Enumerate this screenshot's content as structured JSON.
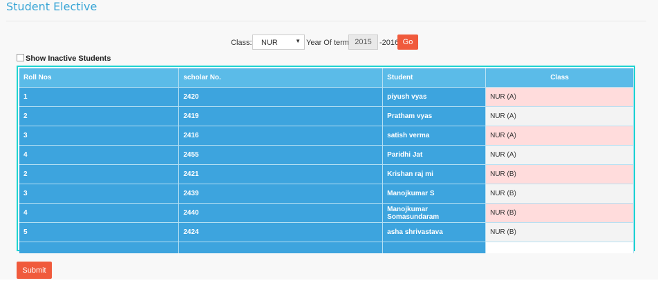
{
  "page": {
    "title": "Student Elective"
  },
  "filters": {
    "class_label": "Class:-",
    "class_value": "NUR",
    "year_label": "Year Of term:-",
    "year_start": "2015",
    "year_end": "-2016",
    "go_label": "Go"
  },
  "inactive_label": "Show Inactive Students",
  "table": {
    "headers": [
      "Roll Nos",
      "scholar No.",
      "Student",
      "Class"
    ],
    "rows": [
      {
        "roll": "1",
        "scholar": "2420",
        "student": "piyush vyas",
        "class": "NUR (A)"
      },
      {
        "roll": "2",
        "scholar": "2419",
        "student": "Pratham vyas",
        "class": "NUR (A)"
      },
      {
        "roll": "3",
        "scholar": "2416",
        "student": "satish verma",
        "class": "NUR (A)"
      },
      {
        "roll": "4",
        "scholar": "2455",
        "student": "Paridhi Jat",
        "class": "NUR (A)"
      },
      {
        "roll": "2",
        "scholar": "2421",
        "student": "Krishan raj mi",
        "class": "NUR (B)"
      },
      {
        "roll": "3",
        "scholar": "2439",
        "student": "Manojkumar S",
        "class": "NUR (B)"
      },
      {
        "roll": "4",
        "scholar": "2440",
        "student": "Manojkumar Somasundaram",
        "class": "NUR (B)"
      },
      {
        "roll": "5",
        "scholar": "2424",
        "student": "asha shrivastava",
        "class": "NUR (B)"
      }
    ]
  },
  "submit_label": "Submit",
  "colors": {
    "header": "#5bbbe8",
    "row": "#3da4de",
    "highlight": "#ffdcdc",
    "button": "#f05a3c",
    "border": "#1fd4d0"
  }
}
